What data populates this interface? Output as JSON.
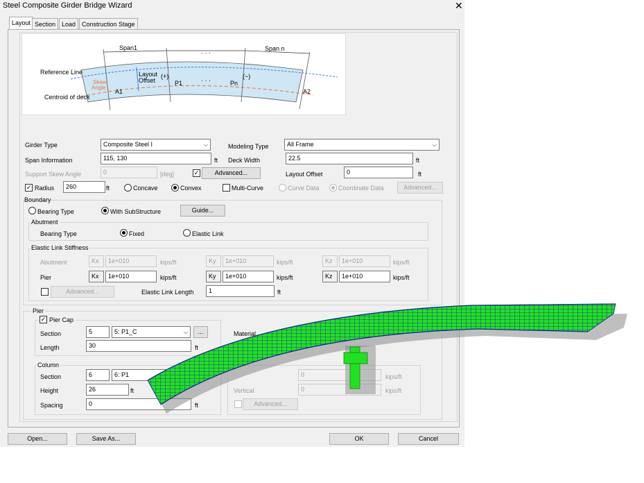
{
  "window": {
    "title": "Steel Composite Girder Bridge Wizard"
  },
  "tabs": [
    "Layout",
    "Section",
    "Load",
    "Construction Stage"
  ],
  "diagram": {
    "span1": "Span1",
    "dots": "· · ·",
    "spann": "Span n",
    "reference_line": "Reference Line",
    "layout_offset_1": "Layout",
    "layout_offset_2": "Offset",
    "plus": "(+)",
    "minus": "(−)",
    "skew_1": "Skew",
    "skew_2": "Angle",
    "a1": "A1",
    "a2": "A2",
    "p1": "P1",
    "pn": "Pn",
    "centroid": "Centroid of deck"
  },
  "form": {
    "girder_type_label": "Girder Type",
    "girder_type_value": "Composite Steel I",
    "modeling_type_label": "Modeling Type",
    "modeling_type_value": "All Frame",
    "span_info_label": "Span Information",
    "span_info_value": "115, 130",
    "unit_ft": "ft",
    "deck_width_label": "Deck Width",
    "deck_width_value": "22.5",
    "skew_label": "Support Skew Angle",
    "skew_value": "0",
    "skew_unit": "[deg]",
    "advanced_label": "Advanced...",
    "layout_offset_label": "Layout Offset",
    "layout_offset_value": "0",
    "radius_label": "Radius",
    "radius_value": "260",
    "concave_label": "Concave",
    "convex_label": "Convex",
    "multi_curve_label": "Multi-Curve",
    "curve_data_label": "Curve Data",
    "coordinate_data_label": "Coordinate Data"
  },
  "boundary": {
    "title": "Boundary",
    "bearing_type_label": "Bearing Type",
    "with_substructure_label": "With SubStructure",
    "guide_label": "Guide...",
    "abutment_title": "Abutment",
    "abut_bearing_label": "Bearing Type",
    "fixed_label": "Fixed",
    "elastic_link_label": "Elastic Link",
    "els_title": "Elastic Link Stiffness",
    "abutment_row": "Abutment",
    "pier_row": "Pier",
    "kx": "Kx",
    "ky": "Ky",
    "kz": "Kz",
    "k_value": "1e+010",
    "k_unit": "kips/ft",
    "els_advanced": "Advanced...",
    "elastic_link_length_label": "Elastic Link Length",
    "elastic_link_length_value": "1"
  },
  "pier": {
    "title": "Pier",
    "pier_cap_label": "Pier Cap",
    "section_label": "Section",
    "cap_section_no": "5",
    "cap_section_name": "5: P1_C",
    "browse": "...",
    "length_label": "Length",
    "length_value": "30",
    "material_label": "Material",
    "column_title": "Column",
    "col_section_no": "6",
    "col_section_name": "6: P1",
    "height_label": "Height",
    "height_value": "26",
    "spacing_label": "Spacing",
    "spacing_value": "0",
    "vertical_label": "Vertical",
    "stiff_value_1": "0",
    "stiff_value_2": "0",
    "stiff_unit": "kips/ft",
    "advanced": "Advanced..."
  },
  "footer": {
    "open": "Open...",
    "save_as": "Save As...",
    "ok": "OK",
    "cancel": "Cancel"
  },
  "colors": {
    "deck_green": "#22e022",
    "deck_blue": "#1a1aa8",
    "shadow": "#8a8a8a",
    "diagram_deck": "#cfe6f5"
  }
}
